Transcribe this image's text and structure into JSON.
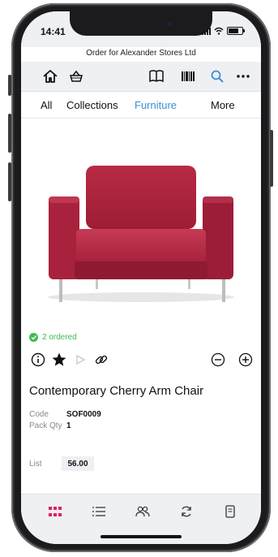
{
  "status": {
    "time": "14:41"
  },
  "header": {
    "order_title": "Order for Alexander Stores Ltd"
  },
  "toolbar": {
    "icons": [
      "home-icon",
      "basket-icon",
      "catalog-book-icon",
      "barcode-icon",
      "search-icon",
      "more-icon"
    ],
    "accent": "#3d8fd6"
  },
  "categories": {
    "items": [
      {
        "label": "All"
      },
      {
        "label": "Collections"
      },
      {
        "label": "Furniture",
        "active": true
      },
      {
        "label": "More"
      }
    ]
  },
  "product": {
    "ordered": "2 ordered",
    "ordered_color": "#3fbb54",
    "name": "Contemporary Cherry Arm Chair",
    "code_label": "Code",
    "code": "SOF0009",
    "pack_label": "Pack Qty",
    "pack_qty": "1",
    "list_label": "List",
    "list_price": "56.00",
    "image_color": "#b3233f"
  },
  "actions": {
    "icons": [
      "info-icon",
      "star-icon",
      "play-icon",
      "link-icon",
      "minus-icon",
      "plus-icon"
    ]
  },
  "tabbar": {
    "icons": [
      "grid-icon",
      "list-icon",
      "customers-icon",
      "sync-icon",
      "orders-icon"
    ],
    "active_color": "#e0245e"
  }
}
